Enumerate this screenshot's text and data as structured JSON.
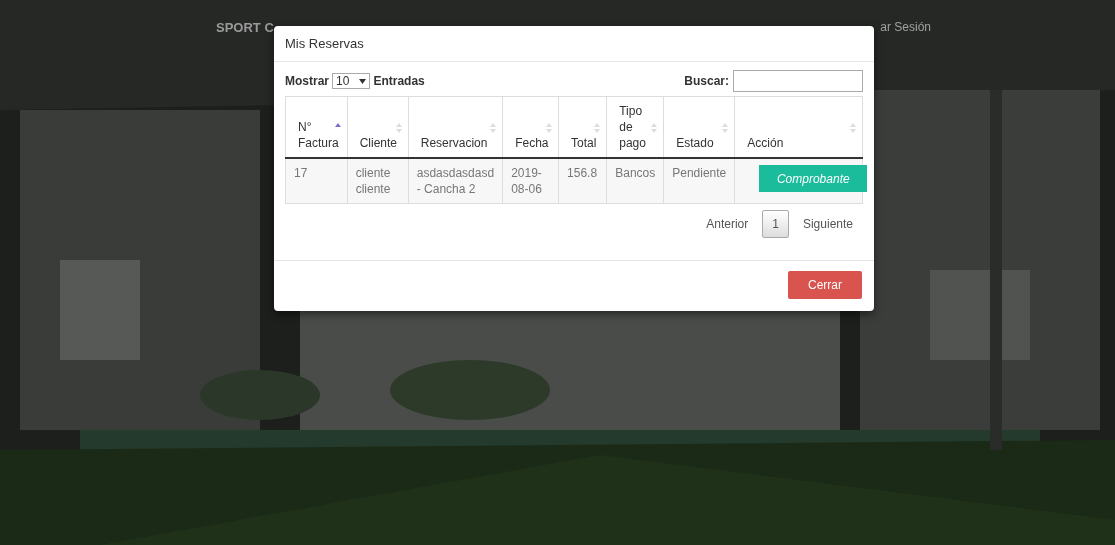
{
  "navbar": {
    "brand": "SPORT C",
    "link": "ar Sesión"
  },
  "modal": {
    "title": "Mis Reservas",
    "length_label_before": "Mostrar",
    "length_value": "10",
    "length_label_after": "Entradas",
    "search_label": "Buscar:",
    "table": {
      "columns": [
        {
          "label": "N° Factura",
          "sorted": true
        },
        {
          "label": "Cliente",
          "sorted": false
        },
        {
          "label": "Reservacion",
          "sorted": false
        },
        {
          "label": "Fecha",
          "sorted": false
        },
        {
          "label": "Total",
          "sorted": false
        },
        {
          "label": "Tipo de pago",
          "sorted": false
        },
        {
          "label": "Estado",
          "sorted": false
        },
        {
          "label": "Acción",
          "sorted": false
        }
      ],
      "rows": [
        {
          "cells": [
            "17",
            "cliente cliente",
            "asdasdasdasd - Cancha 2",
            "2019-08-06",
            "156.8",
            "Bancos",
            "Pendiente"
          ],
          "action": "Comprobante"
        }
      ]
    },
    "pagination": [
      {
        "label": "Anterior",
        "kind": "link",
        "selected": false
      },
      {
        "label": "1",
        "kind": "page",
        "selected": true
      },
      {
        "label": "Siguiente",
        "kind": "link",
        "selected": false
      }
    ],
    "close_button": "Cerrar"
  }
}
